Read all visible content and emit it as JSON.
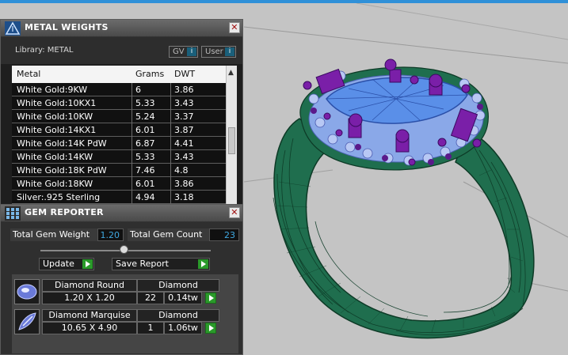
{
  "colors": {
    "accent_bar": "#2f90d8",
    "ring_band": "#1f6e4e",
    "ring_wire": "#0d3a26",
    "prong_purple": "#7a1fa8",
    "gem_blue": "#5a8fe8",
    "halo_blue": "#8aa8e8",
    "value_blue": "#3fa8e0",
    "go_green": "#2a9a2a"
  },
  "metal_panel": {
    "title": "METAL WEIGHTS",
    "icon": "triangle-gauge-icon",
    "library_label": "Library: METAL",
    "toggle_gv": "GV",
    "toggle_user": "User",
    "toggle_marker": "i",
    "close_glyph": "✕",
    "columns": [
      "Metal",
      "Grams",
      "DWT"
    ],
    "rows": [
      {
        "metal": "White Gold:9KW",
        "grams": "6",
        "dwt": "3.86"
      },
      {
        "metal": "White Gold:10KX1",
        "grams": "5.33",
        "dwt": "3.43"
      },
      {
        "metal": "White Gold:10KW",
        "grams": "5.24",
        "dwt": "3.37"
      },
      {
        "metal": "White Gold:14KX1",
        "grams": "6.01",
        "dwt": "3.87"
      },
      {
        "metal": "White Gold:14K PdW",
        "grams": "6.87",
        "dwt": "4.41"
      },
      {
        "metal": "White Gold:14KW",
        "grams": "5.33",
        "dwt": "3.43"
      },
      {
        "metal": "White Gold:18K PdW",
        "grams": "7.46",
        "dwt": "4.8"
      },
      {
        "metal": "White Gold:18KW",
        "grams": "6.01",
        "dwt": "3.86"
      },
      {
        "metal": "Silver:.925 Sterling",
        "grams": "4.94",
        "dwt": "3.18"
      }
    ]
  },
  "gem_panel": {
    "title": "GEM REPORTER",
    "icon": "gem-grid-icon",
    "close_glyph": "✕",
    "total_weight_label": "Total Gem Weight",
    "total_weight_value": "1.20",
    "total_count_label": "Total Gem Count",
    "total_count_value": "23",
    "update_label": "Update",
    "save_label": "Save Report",
    "gems": [
      {
        "shape": "Diamond Round",
        "type": "Diamond",
        "size": "1.20 X 1.20",
        "count": "22",
        "weight": "0.14tw",
        "icon": "round-gem-icon"
      },
      {
        "shape": "Diamond Marquise",
        "type": "Diamond",
        "size": "10.65 X 4.90",
        "count": "1",
        "weight": "1.06tw",
        "icon": "marquise-gem-icon"
      }
    ]
  }
}
